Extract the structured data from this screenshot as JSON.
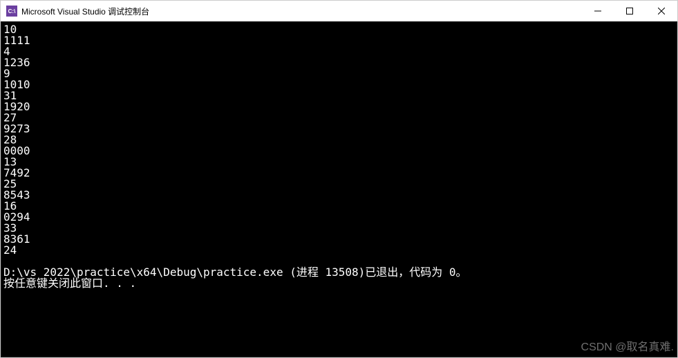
{
  "titlebar": {
    "icon_label": "C:\\",
    "title": "Microsoft Visual Studio 调试控制台"
  },
  "console": {
    "lines": [
      "10",
      "1111",
      "4",
      "1236",
      "9",
      "1010",
      "31",
      "1920",
      "27",
      "9273",
      "28",
      "0000",
      "13",
      "7492",
      "25",
      "8543",
      "16",
      "0294",
      "33",
      "8361",
      "24",
      "",
      "D:\\vs 2022\\practice\\x64\\Debug\\practice.exe (进程 13508)已退出，代码为 0。",
      "按任意键关闭此窗口. . ."
    ]
  },
  "watermark": "CSDN @取名真难."
}
